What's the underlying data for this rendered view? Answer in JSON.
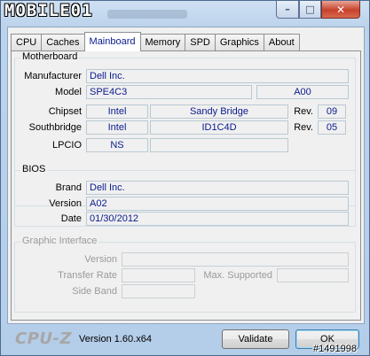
{
  "window": {
    "logo_text": "MOBILE01",
    "buttons": {
      "minimize": "minimize-icon",
      "maximize": "maximize-icon",
      "close": "close-icon"
    }
  },
  "tabs": [
    {
      "label": "CPU"
    },
    {
      "label": "Caches"
    },
    {
      "label": "Mainboard",
      "active": true
    },
    {
      "label": "Memory"
    },
    {
      "label": "SPD"
    },
    {
      "label": "Graphics"
    },
    {
      "label": "About"
    }
  ],
  "motherboard": {
    "legend": "Motherboard",
    "manufacturer_label": "Manufacturer",
    "manufacturer": "Dell Inc.",
    "model_label": "Model",
    "model": "SPE4C3",
    "model_rev": "A00",
    "chipset_label": "Chipset",
    "chipset_vendor": "Intel",
    "chipset_name": "Sandy Bridge",
    "chipset_rev_label": "Rev.",
    "chipset_rev": "09",
    "southbridge_label": "Southbridge",
    "southbridge_vendor": "Intel",
    "southbridge_name": "ID1C4D",
    "southbridge_rev_label": "Rev.",
    "southbridge_rev": "05",
    "lpcio_label": "LPCIO",
    "lpcio_vendor": "NS",
    "lpcio_name": ""
  },
  "bios": {
    "legend": "BIOS",
    "brand_label": "Brand",
    "brand": "Dell Inc.",
    "version_label": "Version",
    "version": "A02",
    "date_label": "Date",
    "date": "01/30/2012"
  },
  "graphic_interface": {
    "legend": "Graphic Interface",
    "version_label": "Version",
    "version": "",
    "transfer_rate_label": "Transfer Rate",
    "transfer_rate": "",
    "max_supported_label": "Max. Supported",
    "max_supported": "",
    "side_band_label": "Side Band",
    "side_band": ""
  },
  "footer": {
    "app_logo": "CPU-Z",
    "version": "Version 1.60.x64",
    "validate_label": "Validate",
    "ok_label": "OK",
    "watermark": "#1491998"
  },
  "colors": {
    "value_text": "#0a1a8e",
    "close_button": "#c8412b"
  }
}
